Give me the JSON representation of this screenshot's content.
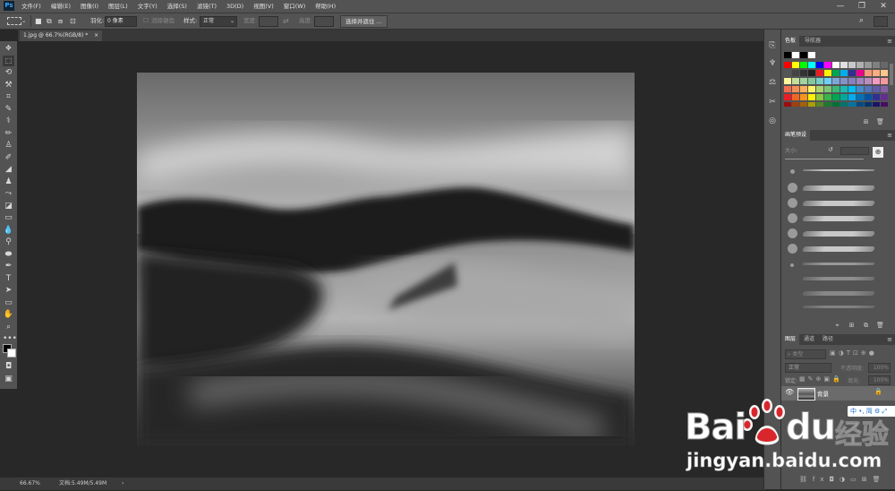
{
  "app": {
    "logo": "Ps",
    "menu": [
      "文件(F)",
      "编辑(E)",
      "图像(I)",
      "图层(L)",
      "文字(Y)",
      "选择(S)",
      "滤镜(T)",
      "3D(D)",
      "视图(V)",
      "窗口(W)",
      "帮助(H)"
    ],
    "window_controls": [
      "—",
      "❐",
      "✕"
    ]
  },
  "options": {
    "feather_label": "羽化:",
    "feather_value": "0 像素",
    "antialias_label": "消除锯齿",
    "style_label": "样式:",
    "style_value": "正常",
    "width_label": "宽度:",
    "height_label": "高度:",
    "select_mask_button": "选择并遮住 ..."
  },
  "document": {
    "tab_title": "1.jpg @ 66.7%(RGB/8) *",
    "tab_close": "×"
  },
  "status": {
    "zoom": "66.67%",
    "doc_info": "文档:5.49M/5.49M",
    "arrow": "›"
  },
  "panels": {
    "swatches_tab": "色板",
    "swatches_tab2": "导航器",
    "brush_presets_tab": "画笔预设",
    "size_label": "大小:",
    "layers_tab": "图层",
    "channels_tab": "通道",
    "paths_tab": "路径",
    "kind_label": "类型",
    "blend_mode": "正常",
    "opacity_label": "不透明度:",
    "opacity_value": "100%",
    "lock_label": "锁定:",
    "fill_label": "填充:",
    "fill_value": "100%",
    "layer_name": "背景"
  },
  "colors": {
    "ui_bg": "#535353",
    "canvas_bg": "#282828",
    "watermark_red": "#d9262c"
  },
  "watermark": {
    "brand_left": "Bai",
    "brand_right": "du",
    "brand_cn": "经验",
    "url": "jingyan.baidu.com",
    "ime": "中 •, 简 ⚙ ⤢"
  }
}
